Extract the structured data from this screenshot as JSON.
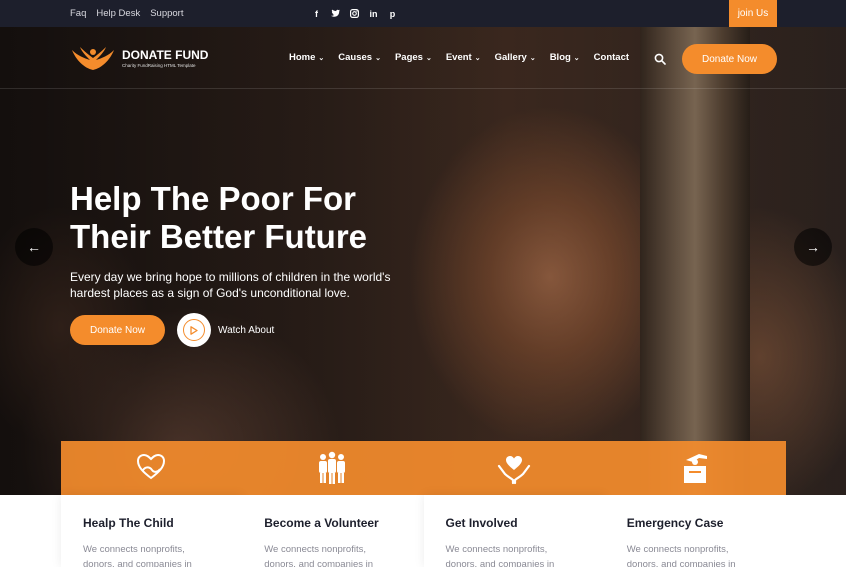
{
  "topbar": {
    "links": [
      "Faq",
      "Help Desk",
      "Support"
    ],
    "social_icons": [
      "facebook-icon",
      "twitter-icon",
      "instagram-icon",
      "linkedin-icon",
      "pinterest-icon"
    ],
    "social_glyphs": [
      "f",
      "t",
      "◎",
      "in",
      "p"
    ],
    "join_label": "join Us"
  },
  "brand": {
    "name": "DONATE FUND",
    "tagline": "Charity FundRaising HTML Template"
  },
  "nav": {
    "items": [
      {
        "label": "Home",
        "caret": true
      },
      {
        "label": "Causes",
        "caret": true
      },
      {
        "label": "Pages",
        "caret": true
      },
      {
        "label": "Event",
        "caret": true
      },
      {
        "label": "Gallery",
        "caret": true
      },
      {
        "label": "Blog",
        "caret": true
      },
      {
        "label": "Contact",
        "caret": false
      }
    ],
    "donate_label": "Donate Now"
  },
  "hero": {
    "title_line1": "Help The Poor For",
    "title_line2": "Their Better Future",
    "text_line1": "Every day we bring hope to millions of children in the world's",
    "text_line2": "hardest places as a sign of God's unconditional love.",
    "donate_label": "Donate Now",
    "watch_label": "Watch About",
    "prev_arrow": "←",
    "next_arrow": "→"
  },
  "features": [
    {
      "icon": "heart-hands-icon",
      "title": "Healp The Child",
      "line1": "We connects nonprofits,",
      "line2": "donors, and companies in"
    },
    {
      "icon": "volunteers-icon",
      "title": "Become a Volunteer",
      "line1": "We connects nonprofits,",
      "line2": "donors, and companies in"
    },
    {
      "icon": "heart-in-hands-icon",
      "title": "Get Involved",
      "line1": "We connects nonprofits,",
      "line2": "donors, and companies in"
    },
    {
      "icon": "donation-box-icon",
      "title": "Emergency Case",
      "line1": "We connects nonprofits,",
      "line2": "donors, and companies in"
    }
  ],
  "colors": {
    "accent": "#f48c2c",
    "topbar_bg": "#1d1f2c",
    "heading": "#1d1f2c",
    "body_text": "#8a8a95"
  }
}
